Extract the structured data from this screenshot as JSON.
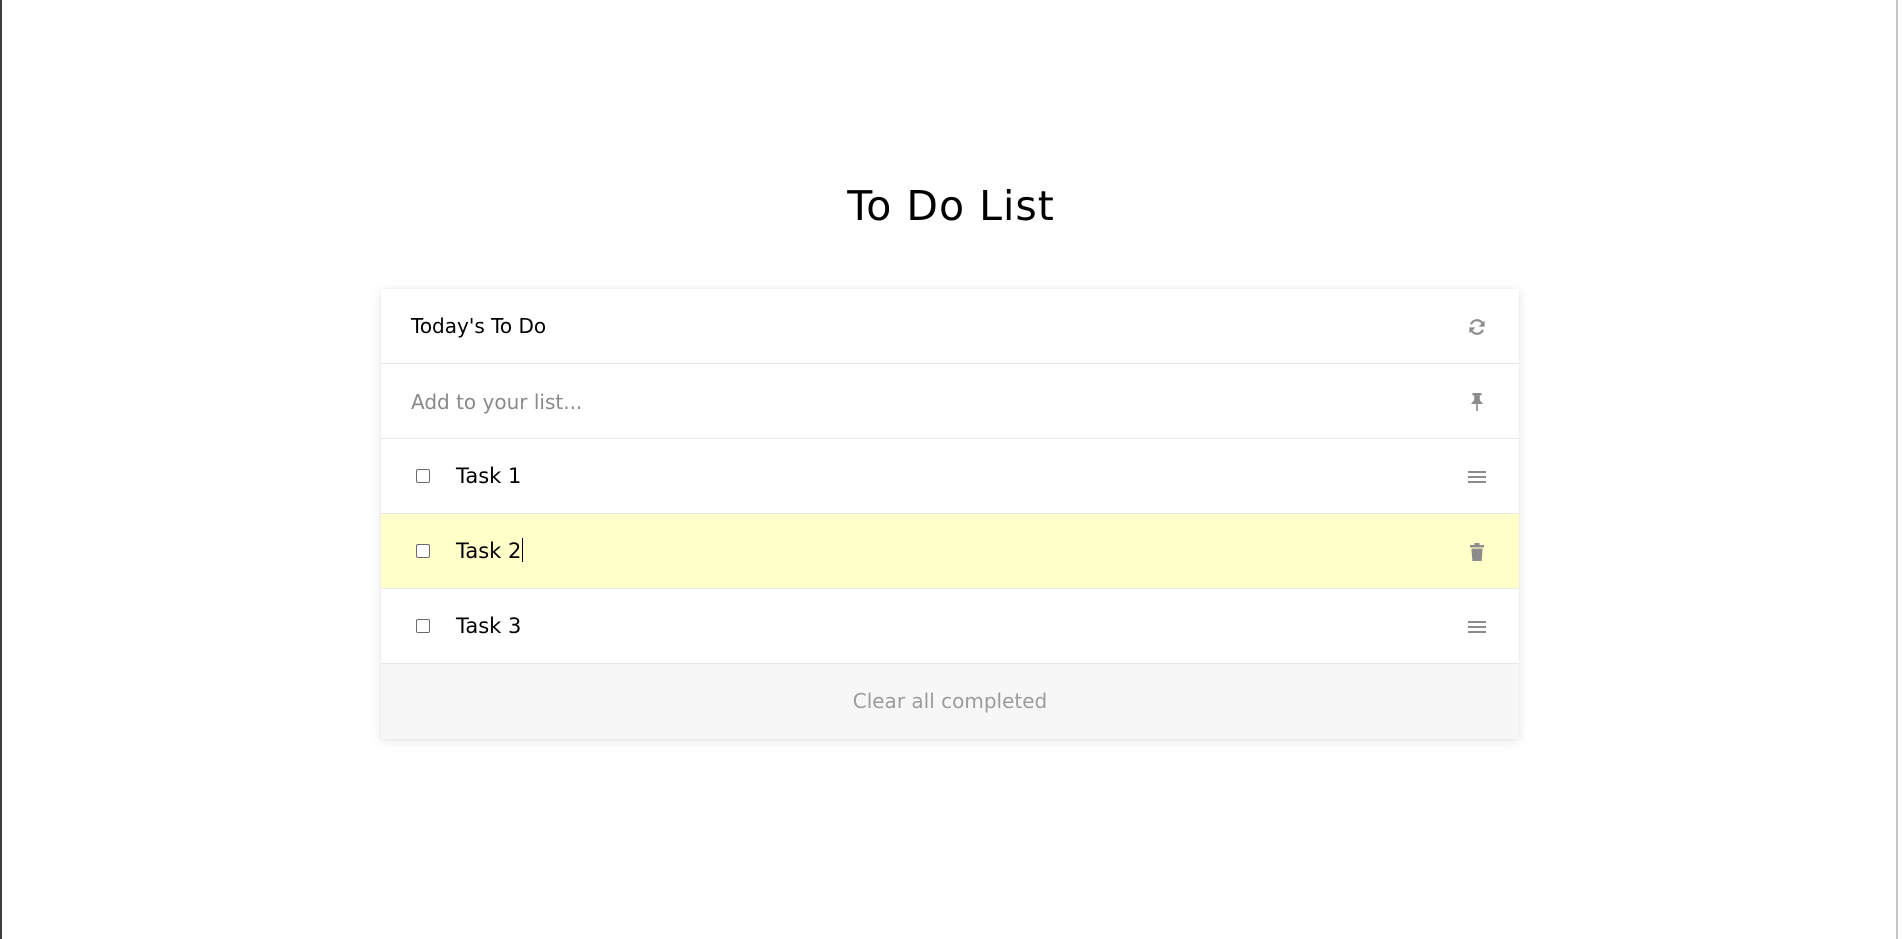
{
  "page": {
    "title": "To Do List"
  },
  "card": {
    "header": {
      "label": "Today's To Do",
      "refresh_icon": "refresh-icon"
    },
    "add": {
      "placeholder": "Add to your list...",
      "value": "",
      "pin_icon": "pin-icon"
    },
    "tasks": [
      {
        "label": "Task 1",
        "checked": false,
        "icon": "drag-handle-icon",
        "highlighted": false
      },
      {
        "label": "Task 2",
        "checked": false,
        "icon": "trash-icon",
        "highlighted": true
      },
      {
        "label": "Task 3",
        "checked": false,
        "icon": "drag-handle-icon",
        "highlighted": false
      }
    ],
    "footer": {
      "clear_label": "Clear all completed"
    }
  },
  "colors": {
    "highlight": "#ffffca",
    "icon": "#8c8c8c",
    "muted_text": "#9c9c9c",
    "footer_bg": "#f7f7f7"
  }
}
